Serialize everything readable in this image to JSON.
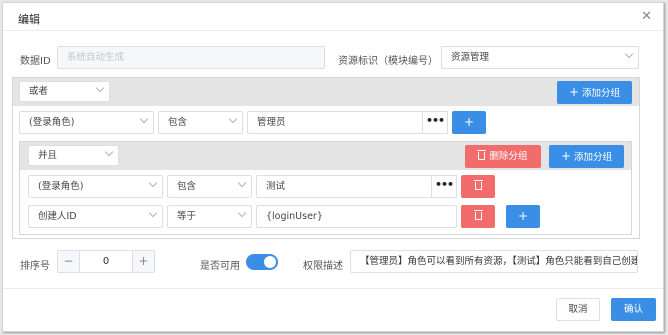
{
  "dialog": {
    "title": "编辑",
    "close_glyph": "✕"
  },
  "form": {
    "data_id_label": "数据ID",
    "data_id_placeholder": "系统自动生成",
    "resource_label": "资源标识（模块编号）",
    "resource_value": "资源管理"
  },
  "outer_group": {
    "logic": "或者",
    "add_group": "添加分组",
    "condition": {
      "field": "(登录角色)",
      "operator": "包含",
      "value": "管理员",
      "dots": "•••"
    }
  },
  "inner_group": {
    "logic": "并且",
    "delete_group": "删除分组",
    "add_group": "添加分组",
    "conditions": [
      {
        "field": "(登录角色)",
        "operator": "包含",
        "value": "测试",
        "dots": "•••"
      },
      {
        "field": "创建人ID",
        "operator": "等于",
        "value": "{loginUser}"
      }
    ]
  },
  "bottom": {
    "sort_label": "排序号",
    "sort_value": "0",
    "minus": "−",
    "plus": "+",
    "enabled_label": "是否可用",
    "enabled": true,
    "desc_label": "权限描述",
    "desc_value": "【管理员】角色可以看到所有资源，【测试】角色只能看到自己创建的资源"
  },
  "footer": {
    "cancel": "取消",
    "confirm": "确认"
  },
  "colors": {
    "primary": "#3a8ee6",
    "danger": "#f36c6c",
    "group_bar": "#e4e4e4"
  },
  "icons": {
    "plus": "+",
    "trash": "trash-icon",
    "chevron": "chevron-down-icon",
    "close": "close-icon"
  }
}
